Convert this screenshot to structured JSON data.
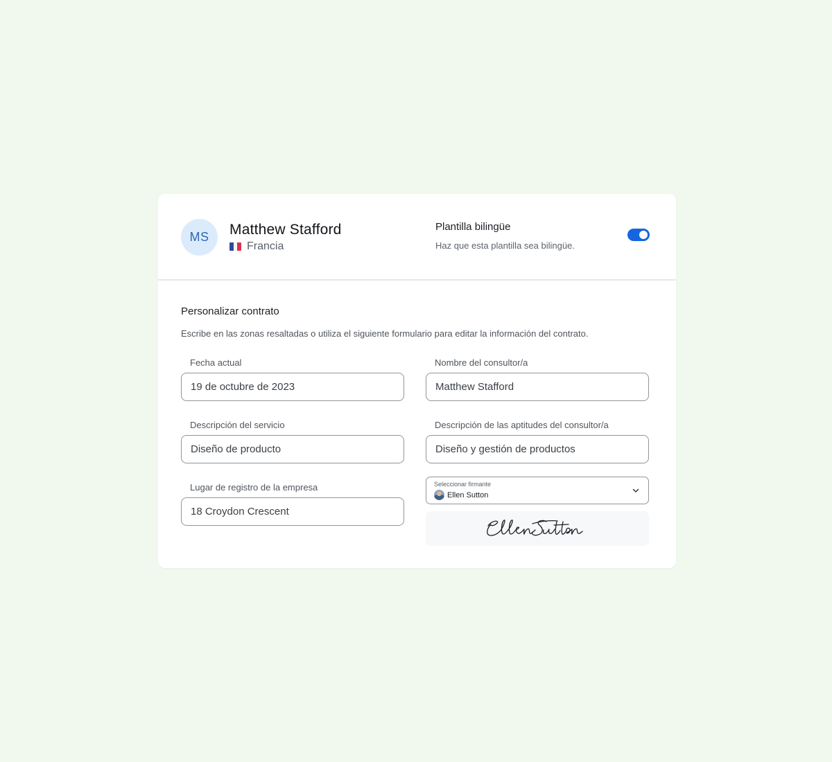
{
  "user": {
    "initials": "MS",
    "name": "Matthew Stafford",
    "country": "Francia"
  },
  "bilingual": {
    "title": "Plantilla bilingüe",
    "description": "Haz que esta plantilla sea bilingüe.",
    "enabled": true
  },
  "contract": {
    "title": "Personalizar contrato",
    "description": "Escribe en las zonas resaltadas o utiliza el siguiente formulario para editar la información del contrato.",
    "fields": {
      "current_date": {
        "label": "Fecha actual",
        "value": "19 de octubre de 2023"
      },
      "consultant_name": {
        "label": "Nombre del consultor/a",
        "value": "Matthew Stafford"
      },
      "service_description": {
        "label": "Descripción del servicio",
        "value": "Diseño de producto"
      },
      "consultant_skills": {
        "label": "Descripción de las aptitudes del consultor/a",
        "value": "Diseño y gestión de productos"
      },
      "company_registration": {
        "label": "Lugar de registro de la empresa",
        "value": "18 Croydon Crescent"
      }
    },
    "signer": {
      "caption": "Seleccionar firmante",
      "value": "Ellen Sutton",
      "signature": "Ellen Sutton"
    }
  },
  "colors": {
    "background": "#f1f8ee",
    "toggle_on": "#1565e0",
    "avatar_bg": "#dcebfb",
    "avatar_text": "#2c69b8"
  },
  "icons": {
    "flag": "france-flag-icon",
    "chevron": "chevron-down-icon",
    "signer_avatar": "signer-avatar-icon"
  }
}
